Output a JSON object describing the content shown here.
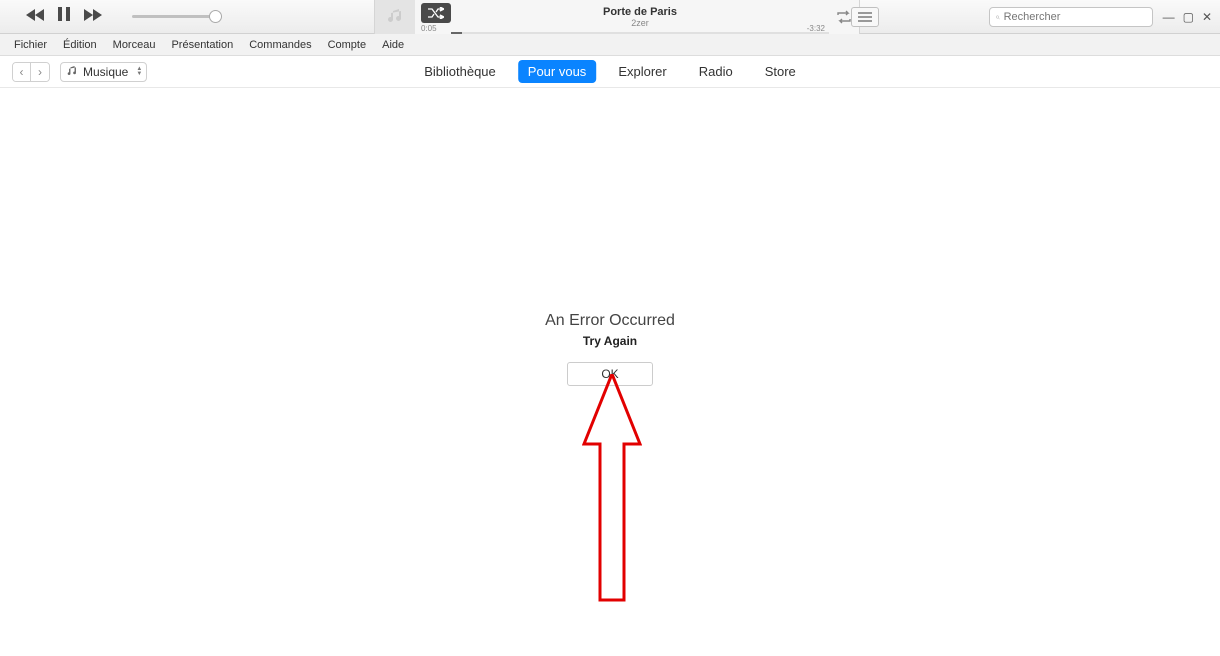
{
  "player": {
    "now_playing_title": "Porte de Paris",
    "now_playing_artist": "2zer",
    "time_elapsed": "0:05",
    "time_remaining": "-3:32"
  },
  "search": {
    "placeholder": "Rechercher"
  },
  "menu": {
    "items": [
      "Fichier",
      "Édition",
      "Morceau",
      "Présentation",
      "Commandes",
      "Compte",
      "Aide"
    ]
  },
  "media_selector": {
    "label": "Musique"
  },
  "tabs": {
    "items": [
      "Bibliothèque",
      "Pour vous",
      "Explorer",
      "Radio",
      "Store"
    ],
    "active_index": 1
  },
  "error": {
    "title": "An Error Occurred",
    "subtitle": "Try Again",
    "button_label": "OK"
  }
}
